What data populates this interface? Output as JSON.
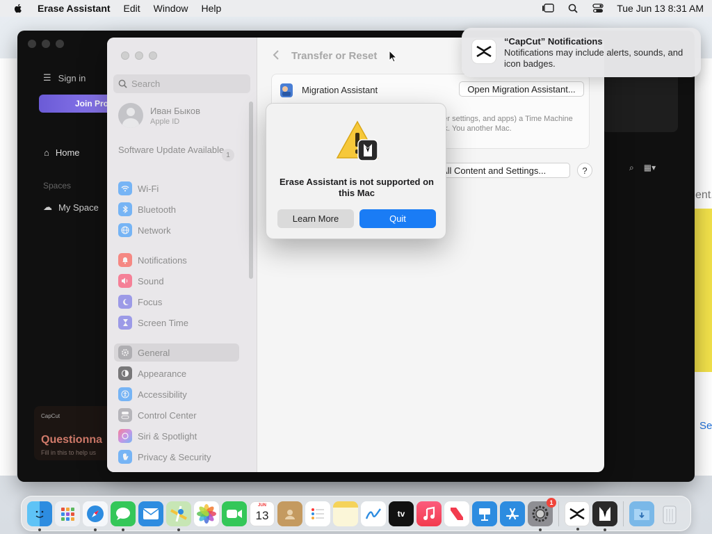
{
  "menubar": {
    "app_name": "Erase Assistant",
    "menus": [
      "Edit",
      "Window",
      "Help"
    ],
    "clock": "Tue Jun 13  8:31 AM"
  },
  "capcut": {
    "sign_in": "Sign in",
    "join": "Join Pro",
    "home": "Home",
    "spaces": "Spaces",
    "my_space": "My Space",
    "brand": "CapCut",
    "questionnaire": "Questionna",
    "fill_text": "Fill in this to help us"
  },
  "background": {
    "fragment_text": "ent.",
    "fragment_link": "Se"
  },
  "settings": {
    "search_placeholder": "Search",
    "account": {
      "name": "Иван Быков",
      "sub": "Apple ID"
    },
    "software_update": "Software Update Available",
    "update_count": "1",
    "items": [
      {
        "label": "Wi-Fi",
        "icon": "wifi-icon",
        "color": "#1a8cff"
      },
      {
        "label": "Bluetooth",
        "icon": "bluetooth-icon",
        "color": "#1a8cff"
      },
      {
        "label": "Network",
        "icon": "globe-icon",
        "color": "#1a8cff"
      },
      {
        "label": "Notifications",
        "icon": "bell-icon",
        "color": "#ff3b30"
      },
      {
        "label": "Sound",
        "icon": "speaker-icon",
        "color": "#ff2d55"
      },
      {
        "label": "Focus",
        "icon": "moon-icon",
        "color": "#5e5ce6"
      },
      {
        "label": "Screen Time",
        "icon": "hourglass-icon",
        "color": "#5e5ce6"
      },
      {
        "label": "General",
        "icon": "gear-icon",
        "color": "#8e8e93"
      },
      {
        "label": "Appearance",
        "icon": "appearance-icon",
        "color": "#1c1c1e"
      },
      {
        "label": "Accessibility",
        "icon": "accessibility-icon",
        "color": "#1a8cff"
      },
      {
        "label": "Control Center",
        "icon": "control-center-icon",
        "color": "#8e8e93"
      },
      {
        "label": "Siri & Spotlight",
        "icon": "siri-icon",
        "color": "#af52de"
      },
      {
        "label": "Privacy & Security",
        "icon": "hand-icon",
        "color": "#1a8cff"
      }
    ],
    "content": {
      "title": "Transfer or Reset",
      "migration_label": "Migration Assistant",
      "open_migration": "Open Migration Assistant...",
      "description": "(data, computer settings, and apps) a Time Machine backup, or disk. You another Mac.",
      "erase_button": "e All Content and Settings...",
      "help": "?"
    }
  },
  "alert": {
    "message": "Erase Assistant is not supported on this Mac",
    "learn_more": "Learn More",
    "quit": "Quit",
    "accent": "#1a7cf5"
  },
  "notification": {
    "title": "“CapCut” Notifications",
    "body": "Notifications may include alerts, sounds, and icon badges."
  },
  "dock": {
    "calendar_month": "JUN",
    "calendar_day": "13",
    "appletv_label": "tv",
    "settings_badge": "1"
  }
}
